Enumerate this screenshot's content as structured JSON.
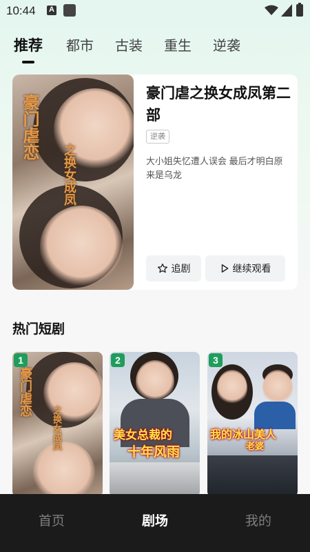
{
  "status_bar": {
    "time": "10:44"
  },
  "tabs": [
    {
      "label": "推荐",
      "active": true
    },
    {
      "label": "都市"
    },
    {
      "label": "古装"
    },
    {
      "label": "重生"
    },
    {
      "label": "逆袭"
    }
  ],
  "featured": {
    "title": "豪门虐之换女成凤第二部",
    "tag": "逆袭",
    "description": "大小姐失忆遭人误会 最后才明白原来是乌龙",
    "poster_text_main": "豪门虐恋",
    "poster_text_sub": "之换女成凤",
    "follow_label": "追剧",
    "continue_label": "继续观看"
  },
  "hot_section": {
    "title": "热门短剧",
    "items": [
      {
        "rank": "1",
        "overlay_main": "豪门虐恋",
        "overlay_sub": "之换女成凤"
      },
      {
        "rank": "2",
        "overlay_line1": "美女总裁的",
        "overlay_line2": "十年风雨"
      },
      {
        "rank": "3",
        "overlay_line1": "我的冰山美人",
        "overlay_line2": "老婆"
      }
    ]
  },
  "bottom_nav": [
    {
      "label": "首页"
    },
    {
      "label": "剧场",
      "active": true
    },
    {
      "label": "我的"
    }
  ],
  "colors": {
    "accent": "#1f9d5c",
    "nav_bg": "#1b1b1b"
  }
}
